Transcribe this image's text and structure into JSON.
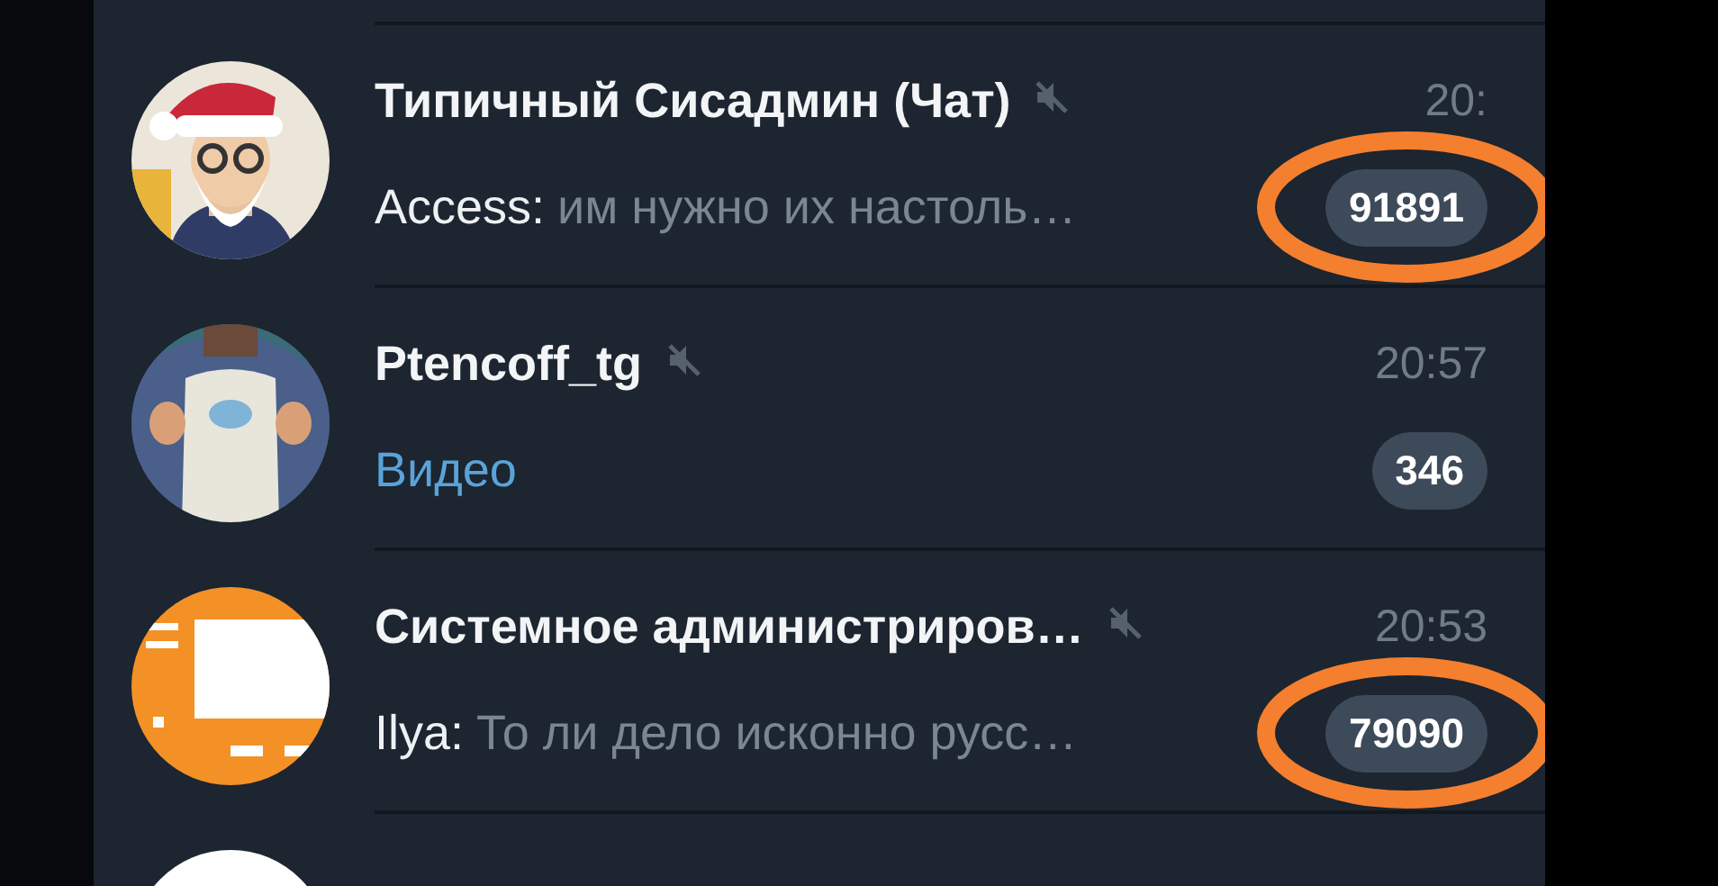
{
  "chats": [
    {
      "avatar": {
        "kind": "picture"
      },
      "name": "Типичный Сисадмин (Чат)",
      "muted": true,
      "time": "20:",
      "sender": "Access:",
      "preview": "им нужно их настоль…",
      "media": false,
      "badge": "91891",
      "circled": true
    },
    {
      "avatar": {
        "kind": "picture"
      },
      "name": "Ptencoff_tg",
      "muted": true,
      "time": "20:57",
      "preview": "Видео",
      "media": true,
      "badge": "346",
      "circled": false
    },
    {
      "avatar": {
        "kind": "logo"
      },
      "name": "Системное администриров…",
      "muted": true,
      "time": "20:53",
      "sender": "Ilya:",
      "preview": "То ли дело исконно русс…",
      "media": false,
      "badge": "79090",
      "circled": true
    },
    {
      "avatar": {
        "kind": "picture"
      }
    }
  ]
}
